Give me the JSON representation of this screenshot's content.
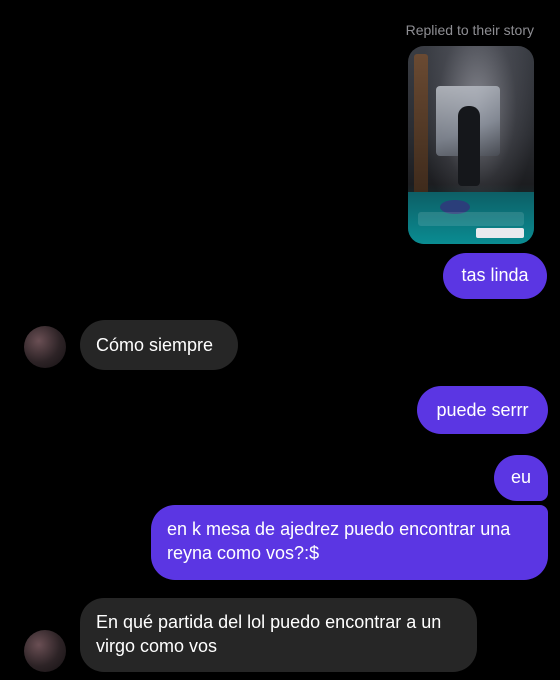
{
  "story_reply": {
    "label": "Replied to their story",
    "thumbnail_name": "story-thumbnail"
  },
  "messages": [
    {
      "id": "m1",
      "direction": "outgoing",
      "text": "tas linda"
    },
    {
      "id": "m2",
      "direction": "incoming",
      "text": "Cómo siempre"
    },
    {
      "id": "m3",
      "direction": "outgoing",
      "text": "puede serrr"
    },
    {
      "id": "m4",
      "direction": "outgoing",
      "text": "eu"
    },
    {
      "id": "m5",
      "direction": "outgoing",
      "text": "en k mesa de ajedrez puedo encontrar una reyna como vos?:$"
    },
    {
      "id": "m6",
      "direction": "incoming",
      "text": "En qué partida del lol puedo encontrar a un virgo como vos"
    }
  ],
  "colors": {
    "background": "#000000",
    "outgoing_bubble": "#5b36e3",
    "incoming_bubble": "#262626",
    "meta_text": "#8e8e93"
  }
}
